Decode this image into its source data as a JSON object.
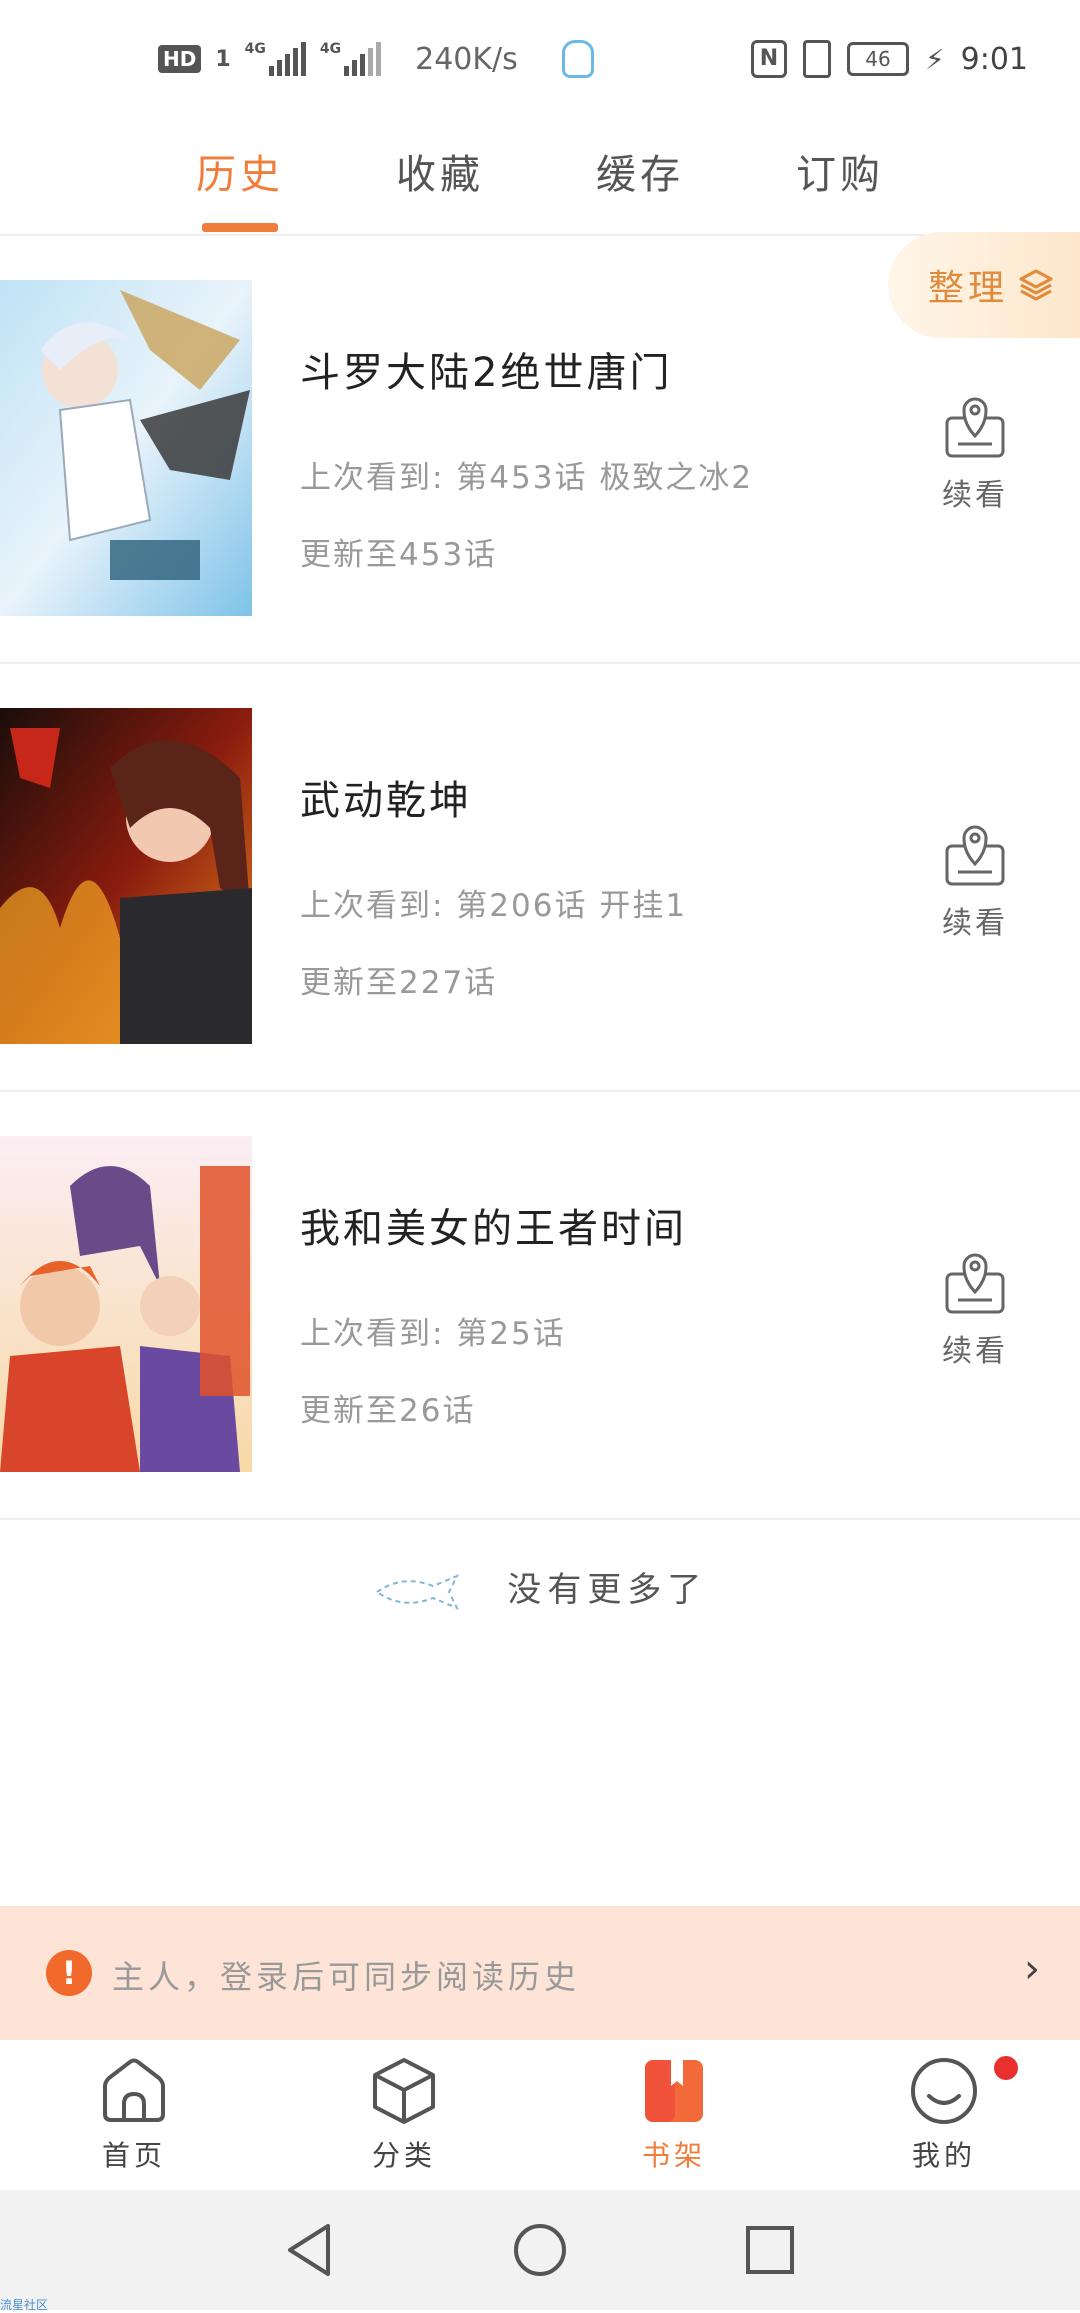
{
  "status_bar": {
    "hd": "HD",
    "hd_sub": "1",
    "signal1_label": "4G",
    "signal2_label": "4G",
    "speed": "240K/s",
    "battery": "46",
    "time": "9:01"
  },
  "tabs": [
    {
      "label": "历史"
    },
    {
      "label": "收藏"
    },
    {
      "label": "缓存"
    },
    {
      "label": "订购"
    }
  ],
  "organize": {
    "label": "整理"
  },
  "comics": [
    {
      "title": "斗罗大陆2绝世唐门",
      "last_read": "上次看到: 第453话 极致之冰2",
      "update": "更新至453话",
      "action": "续看"
    },
    {
      "title": "武动乾坤",
      "last_read": "上次看到: 第206话 开挂1",
      "update": "更新至227话",
      "action": "续看"
    },
    {
      "title": "我和美女的王者时间",
      "last_read": "上次看到: 第25话",
      "update": "更新至26话",
      "action": "续看"
    }
  ],
  "no_more": "没有更多了",
  "login_banner": {
    "text": "主人，登录后可同步阅读历史",
    "arrow": "›"
  },
  "bottom_nav": [
    {
      "label": "首页",
      "icon": "home-icon"
    },
    {
      "label": "分类",
      "icon": "category-cube-icon"
    },
    {
      "label": "书架",
      "icon": "bookshelf-icon"
    },
    {
      "label": "我的",
      "icon": "profile-smile-icon"
    }
  ],
  "watermark": "流星社区",
  "colors": {
    "accent": "#f07d3a",
    "banner_bg": "#fde4d7",
    "warn": "#f26a2b",
    "badge": "#e8312f"
  }
}
